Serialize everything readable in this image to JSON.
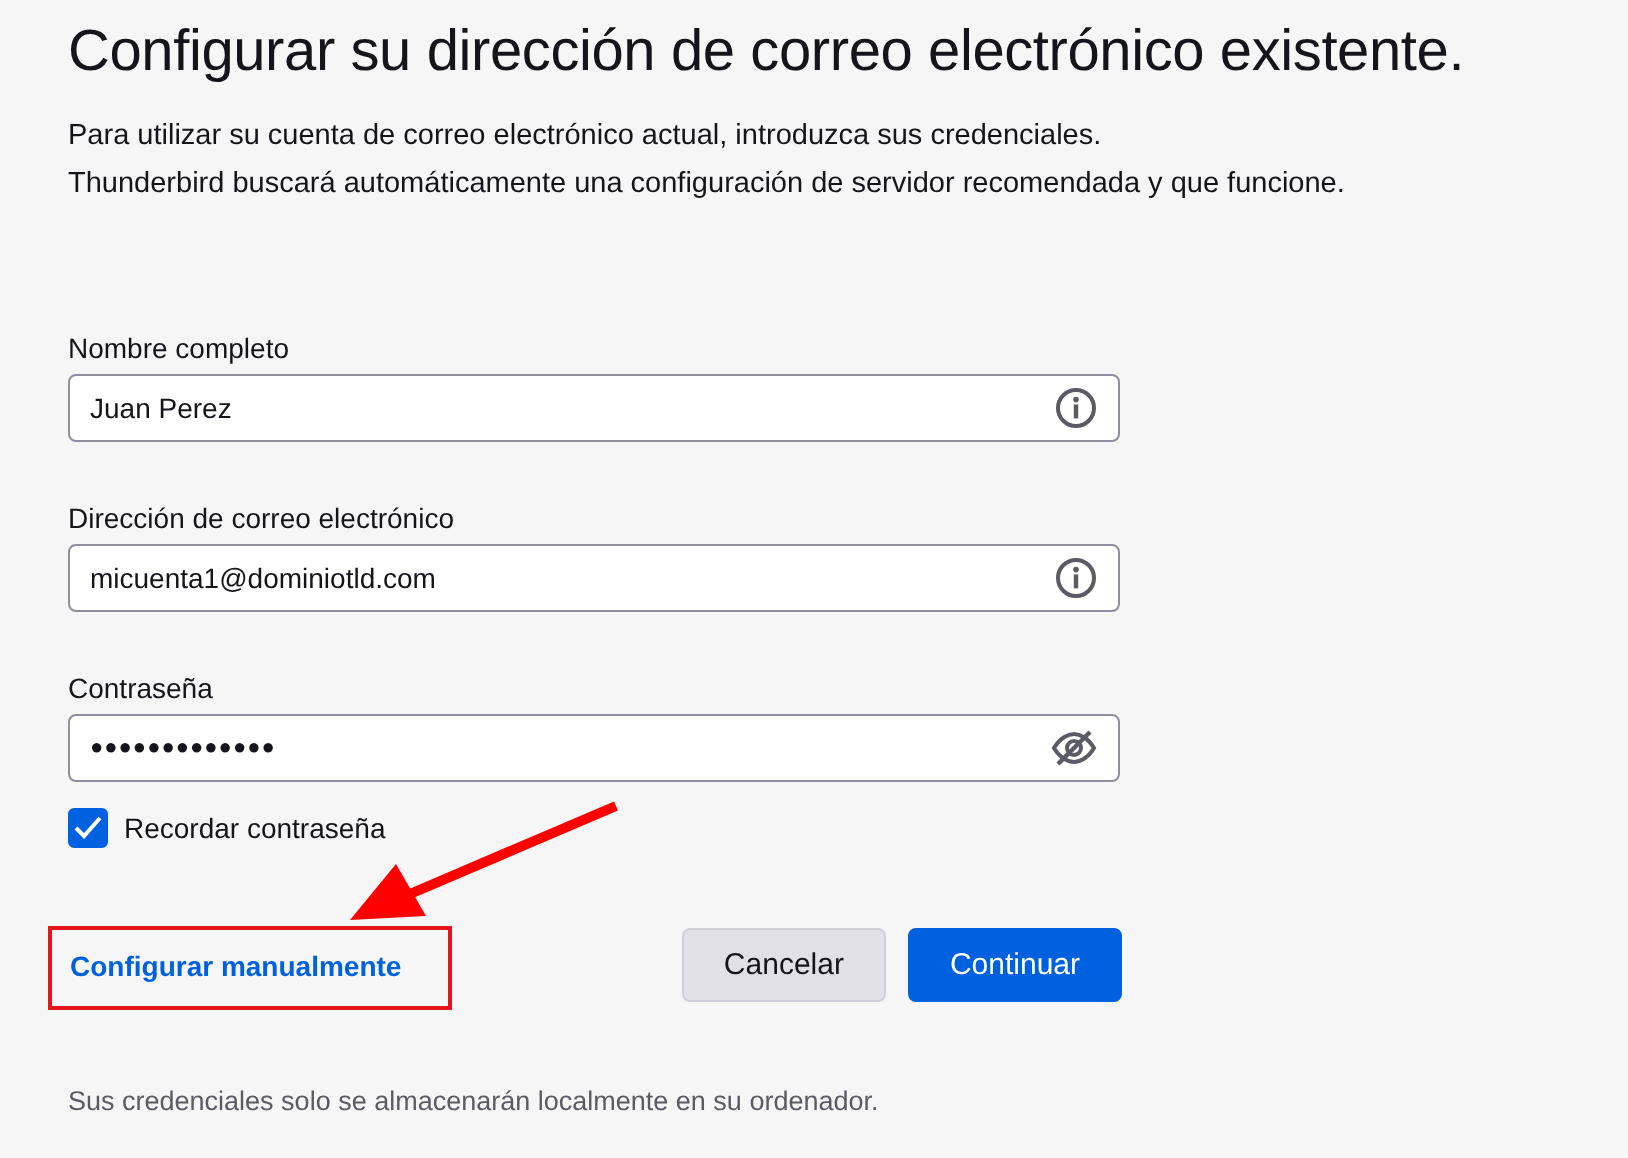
{
  "title": "Configurar su dirección de correo electrónico existente.",
  "description": [
    "Para utilizar su cuenta de correo electrónico actual, introduzca sus credenciales.",
    "Thunderbird buscará automáticamente una configuración de servidor recomendada y que funcione."
  ],
  "fields": [
    {
      "label": "Nombre completo",
      "value": "Juan Perez",
      "kind": "text"
    },
    {
      "label": "Dirección de correo electrónico",
      "value": "micuenta1@dominiotld.com",
      "kind": "text"
    },
    {
      "label": "Contraseña",
      "value": "●●●●●●●●●●●●●",
      "kind": "password"
    }
  ],
  "remember_password": {
    "label": "Recordar contraseña",
    "checked": true
  },
  "manual_link": "Configurar manualmente",
  "buttons": [
    {
      "label": "Cancelar",
      "kind": "secondary"
    },
    {
      "label": "Continuar",
      "kind": "primary"
    }
  ],
  "footer": "Sus credenciales solo se almacenarán localmente en su ordenador."
}
